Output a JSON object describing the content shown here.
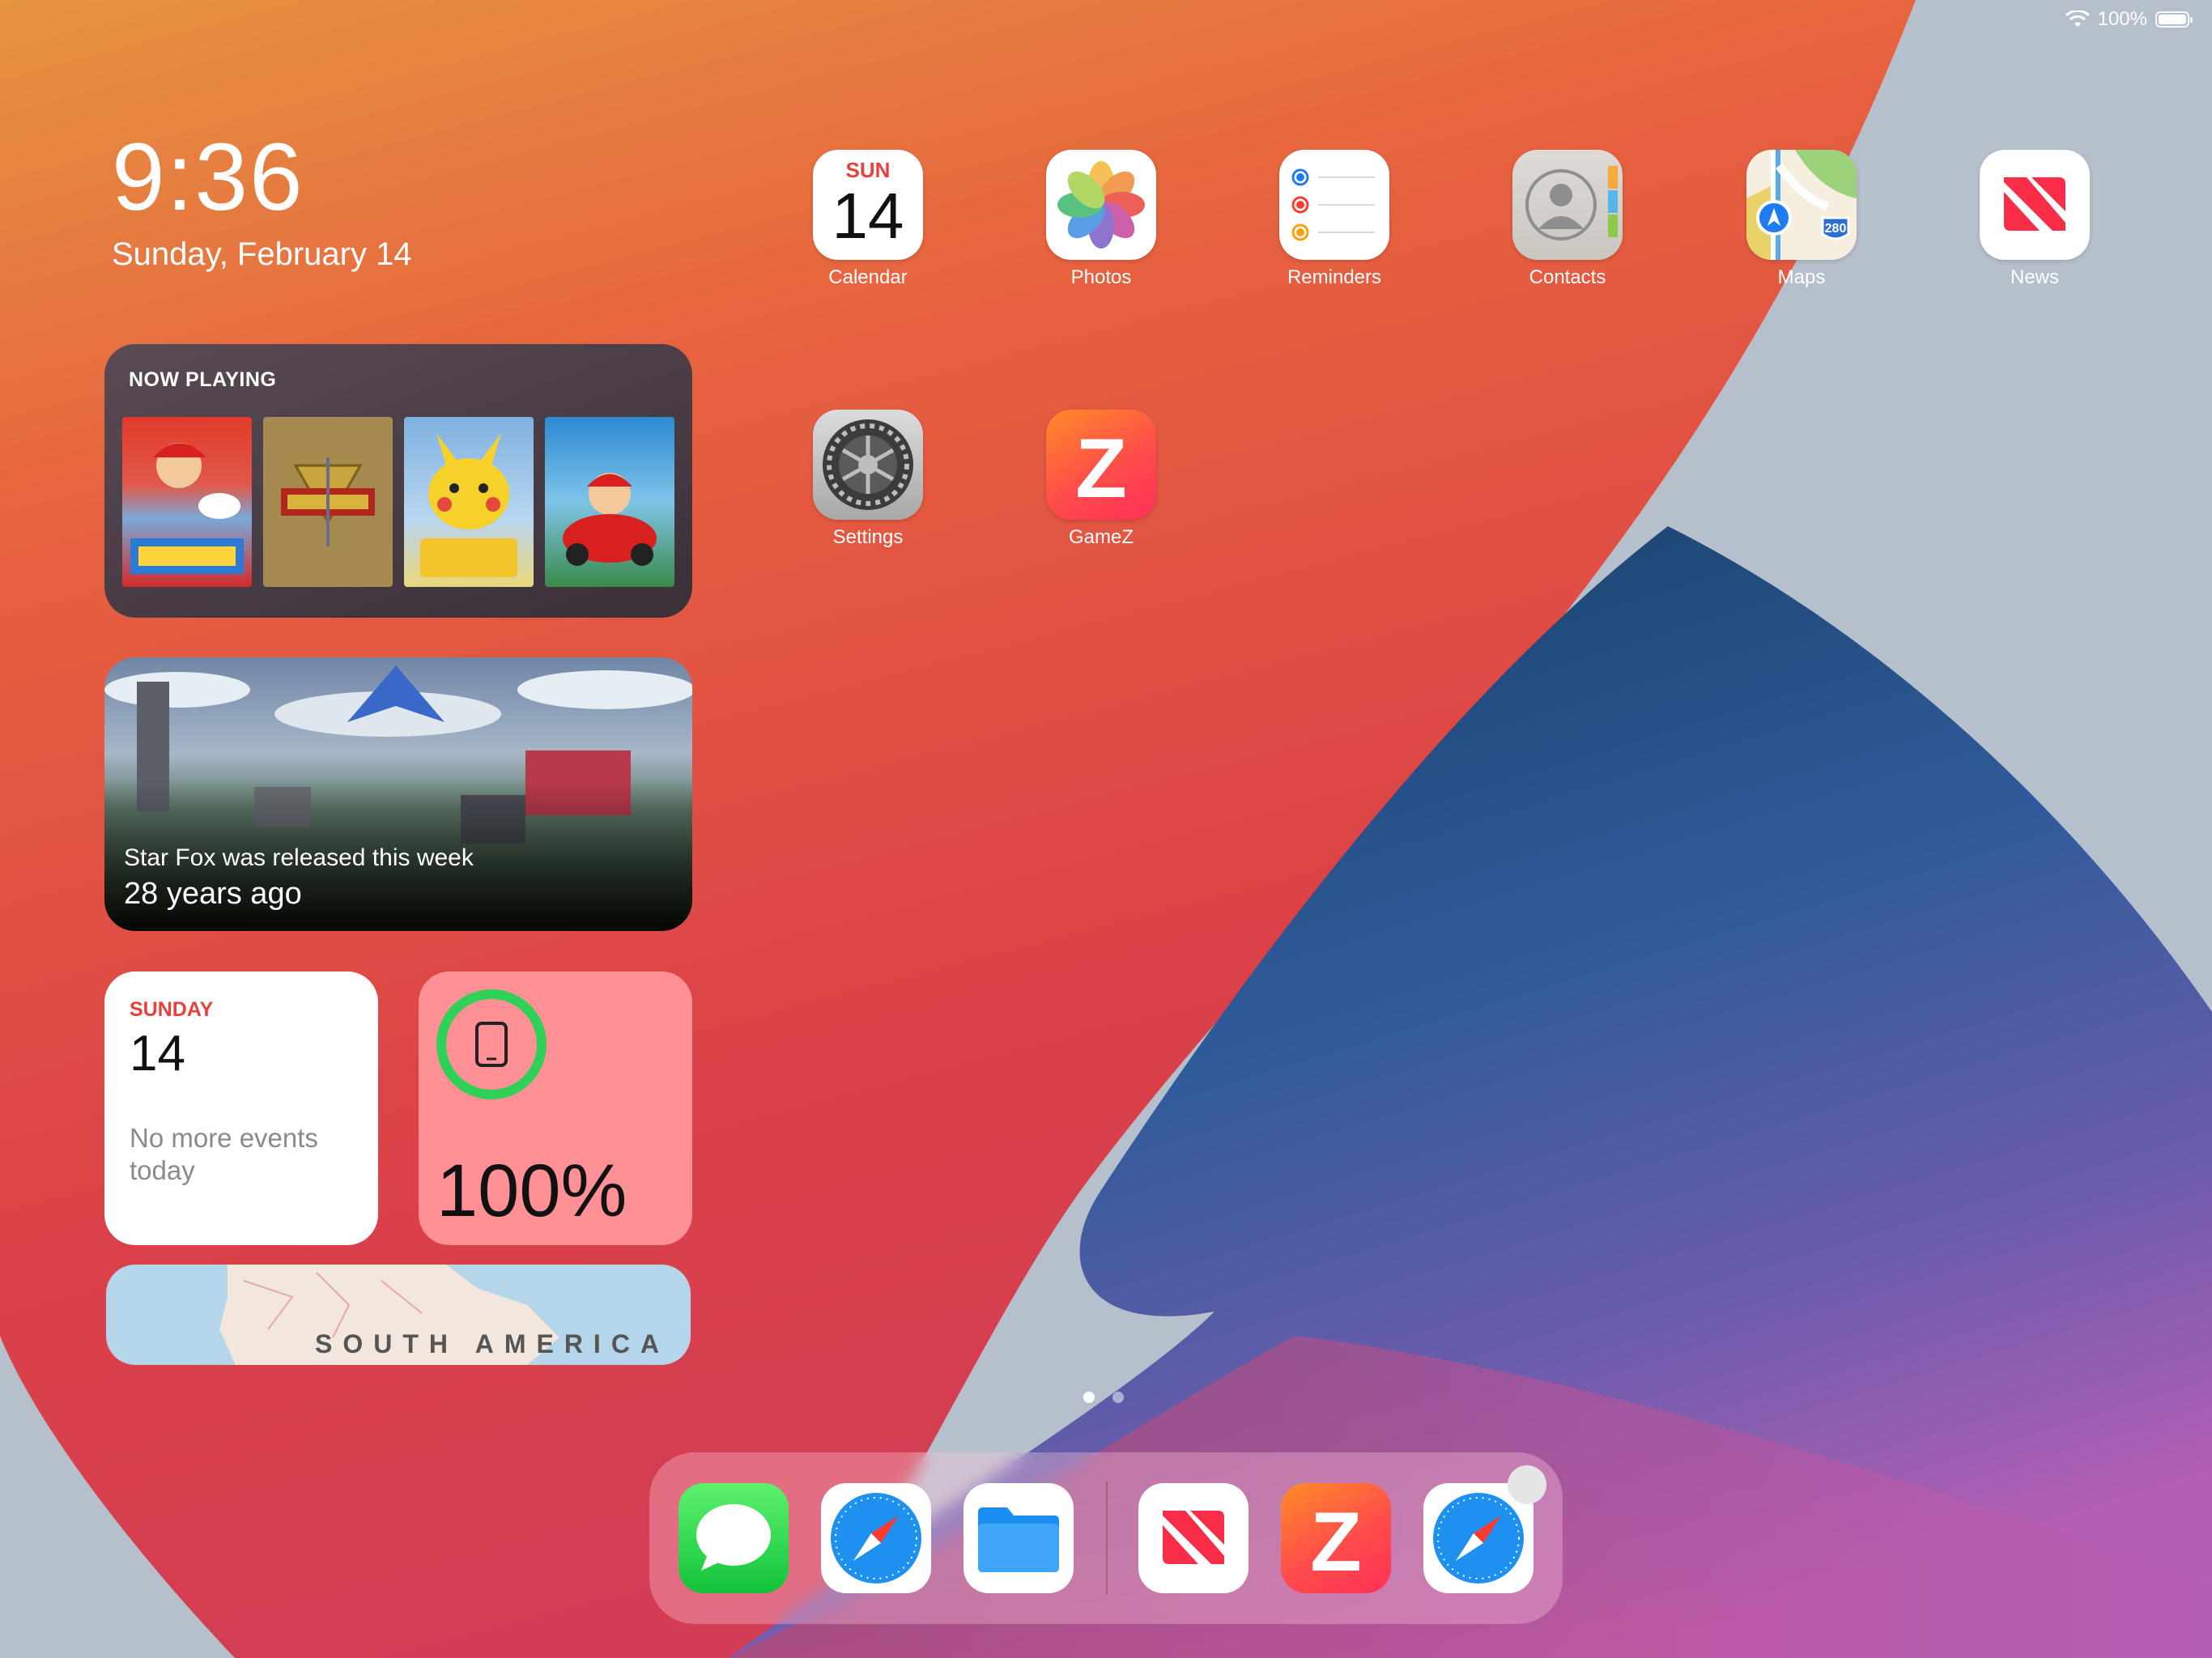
{
  "status_bar": {
    "battery_text": "100%"
  },
  "clock": {
    "time": "9:36",
    "date": "Sunday, February 14"
  },
  "widgets": {
    "now_playing": {
      "title": "NOW PLAYING",
      "covers": [
        {
          "title": "Super Mario Odyssey"
        },
        {
          "title": "The Legend of Zelda: Ocarina of Time"
        },
        {
          "title": "Pokémon: Let's Go, Pikachu!"
        },
        {
          "title": "Mario Kart 8"
        }
      ]
    },
    "memory": {
      "line1": "Star Fox was released this week",
      "line2": "28 years ago"
    },
    "calendar": {
      "day": "SUNDAY",
      "date": "14",
      "events": "No more events today"
    },
    "battery": {
      "percent": "100%",
      "level": 1.0
    },
    "map": {
      "label": "SOUTH AMERICA"
    }
  },
  "apps": [
    {
      "name": "Calendar",
      "icon": "calendar-icon",
      "day": "SUN",
      "date": "14"
    },
    {
      "name": "Photos",
      "icon": "photos-icon"
    },
    {
      "name": "Reminders",
      "icon": "reminders-icon"
    },
    {
      "name": "Contacts",
      "icon": "contacts-icon"
    },
    {
      "name": "Maps",
      "icon": "maps-icon",
      "shield": "280"
    },
    {
      "name": "News",
      "icon": "news-icon"
    },
    {
      "name": "Settings",
      "icon": "settings-icon"
    },
    {
      "name": "GameZ",
      "icon": "gamez-icon",
      "glyph": "Z"
    }
  ],
  "page_dots": {
    "count": 2,
    "active": 0
  },
  "dock": {
    "apps": [
      {
        "icon": "messages-icon"
      },
      {
        "icon": "safari-icon"
      },
      {
        "icon": "files-icon"
      },
      {
        "icon": "news-icon"
      },
      {
        "icon": "gamez-icon",
        "glyph": "Z"
      },
      {
        "icon": "safari-icon"
      }
    ]
  },
  "colors": {
    "calendar_red": "#e8413b",
    "battery_green": "#30d158",
    "battery_widget_bg": "#ff9096"
  }
}
